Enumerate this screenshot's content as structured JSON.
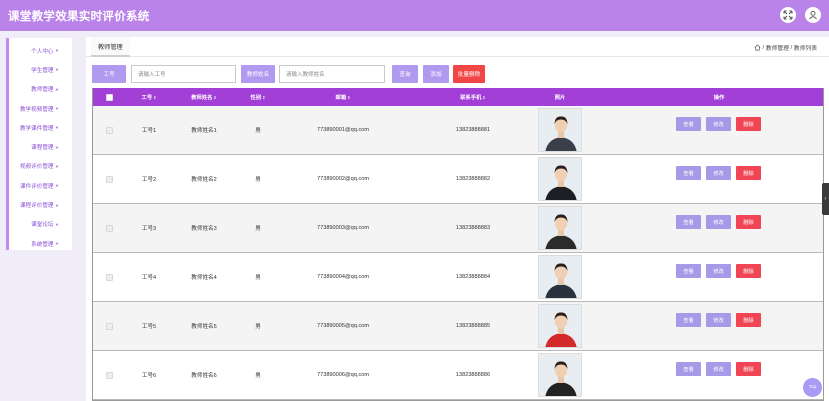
{
  "header": {
    "title": "课堂教学效果实时评价系统",
    "bg_color": "#b983ea",
    "icons": [
      "fullscreen-icon",
      "user-icon"
    ]
  },
  "sidebar": {
    "items": [
      {
        "label": "个人中心"
      },
      {
        "label": "学生管理"
      },
      {
        "label": "教师管理"
      },
      {
        "label": "教学视频管理"
      },
      {
        "label": "教学课件管理"
      },
      {
        "label": "课程管理"
      },
      {
        "label": "视频评价管理"
      },
      {
        "label": "课件评价管理"
      },
      {
        "label": "课程评价管理"
      },
      {
        "label": "课堂论坛"
      },
      {
        "label": "系统管理"
      }
    ]
  },
  "main": {
    "tab_label": "教师管理",
    "breadcrumb": [
      "教师管理",
      "教师列表"
    ],
    "search": {
      "field1_label": "工号",
      "field1_placeholder": "请输入工号",
      "field2_label": "教师姓名",
      "field2_placeholder": "请输入教师姓名",
      "query_button": "查询",
      "add_button": "添加",
      "batch_delete_button": "批量删除"
    },
    "table": {
      "columns": [
        "工号",
        "教师姓名",
        "性别",
        "邮箱",
        "联系手机",
        "照片",
        "操作"
      ],
      "action_labels": {
        "view": "查看",
        "edit": "修改",
        "delete": "删除"
      },
      "rows": [
        {
          "id": "工号1",
          "name": "教师姓名1",
          "gender": "男",
          "email": "773890001@qq.com",
          "phone": "13823888881"
        },
        {
          "id": "工号2",
          "name": "教师姓名2",
          "gender": "男",
          "email": "773890002@qq.com",
          "phone": "13823888882"
        },
        {
          "id": "工号3",
          "name": "教师姓名3",
          "gender": "男",
          "email": "773890003@qq.com",
          "phone": "13823888883"
        },
        {
          "id": "工号4",
          "name": "教师姓名4",
          "gender": "男",
          "email": "773890004@qq.com",
          "phone": "13823888884"
        },
        {
          "id": "工号5",
          "name": "教师姓名5",
          "gender": "男",
          "email": "773890005@qq.com",
          "phone": "13823888885"
        },
        {
          "id": "工号6",
          "name": "教师姓名6",
          "gender": "男",
          "email": "773890006@qq.com",
          "phone": "13823888886"
        }
      ]
    }
  },
  "back_to_top": "Top",
  "colors": {
    "accent": "#b09af0",
    "table_header": "#a13fd6",
    "danger": "#f04646"
  }
}
